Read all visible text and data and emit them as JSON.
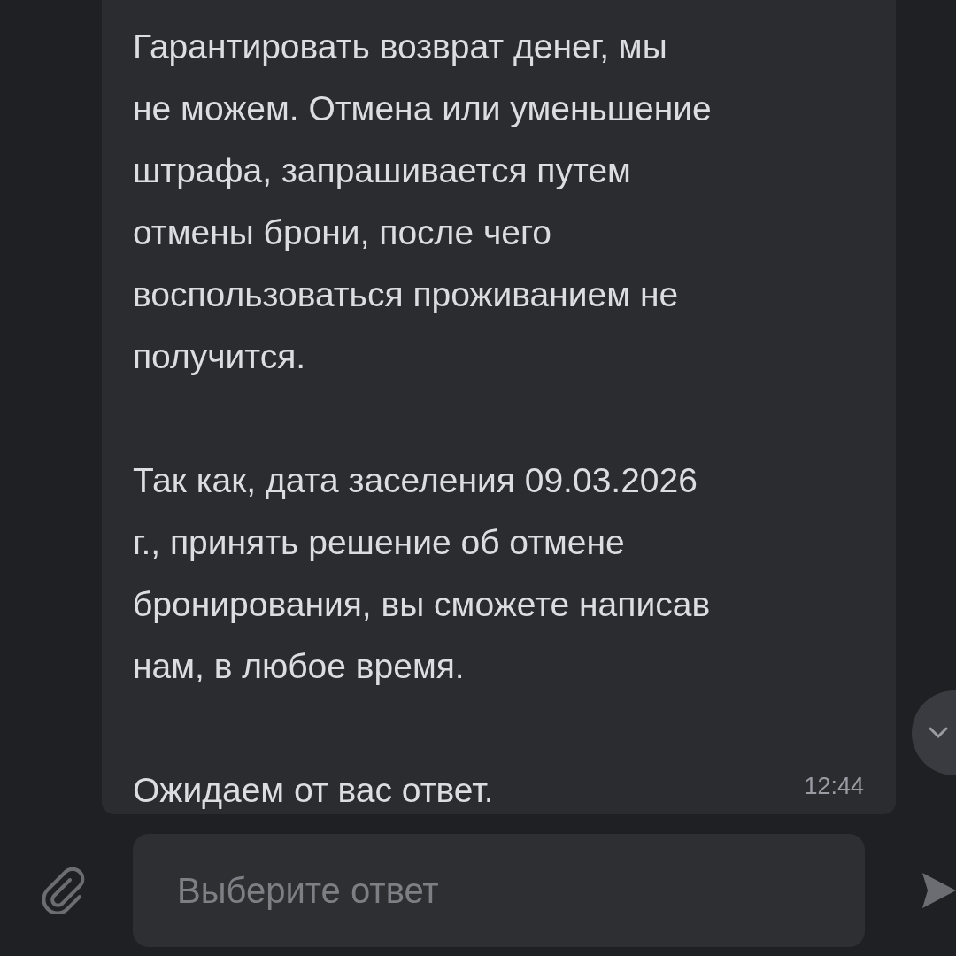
{
  "message": {
    "paragraphs": [
      "Гарантировать возврат денег, мы\nне можем. Отмена или уменьшение\nштрафа, запрашивается путем\nотмены брони, после чего\nвоспользоваться проживанием не\nполучится.",
      "Так как, дата заселения 09.03.2026\nг., принять решение об отмене\nбронирования, вы сможете написав\nнам, в любое время.",
      "Ожидаем от вас ответ."
    ],
    "time": "12:44"
  },
  "composer": {
    "placeholder": "Выберите ответ"
  }
}
